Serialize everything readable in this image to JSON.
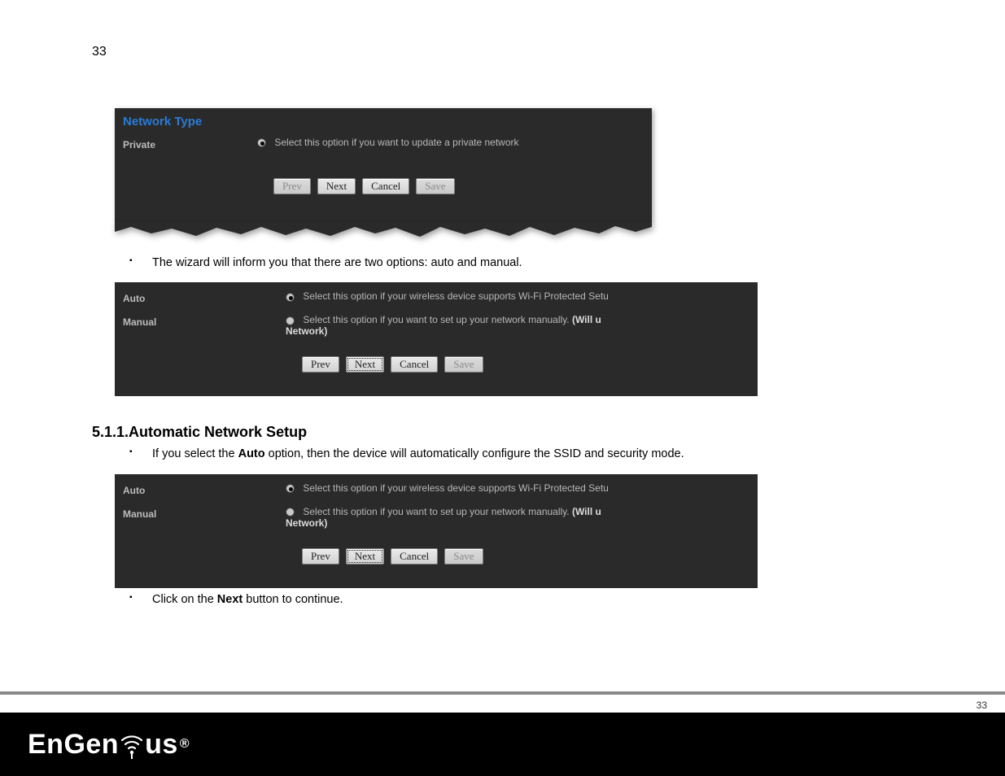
{
  "page_number_top": "33",
  "page_number_bottom": "33",
  "shot1": {
    "header": "Network Type",
    "row_label": "Private",
    "row_desc": "Select this option if you want to update a private network",
    "buttons": {
      "prev": "Prev",
      "next": "Next",
      "cancel": "Cancel",
      "save": "Save"
    }
  },
  "bullet1": "The wizard will inform you that there are two options: auto and manual.",
  "shot2": {
    "auto_label": "Auto",
    "auto_desc": "Select this option if your wireless device supports Wi-Fi Protected Setu",
    "manual_label": "Manual",
    "manual_desc_a": "Select this option if you want to set up your network manually. ",
    "manual_desc_b": "(Will u",
    "manual_desc_c": "Network)",
    "buttons": {
      "prev": "Prev",
      "next": "Next",
      "cancel": "Cancel",
      "save": "Save"
    }
  },
  "section_heading": "5.1.1.Automatic Network Setup",
  "bullet2_a": "If you select the ",
  "bullet2_b": "Auto",
  "bullet2_c": " option, then the device will automatically configure the SSID and security mode.",
  "bullet3_a": "Click on the ",
  "bullet3_b": "Next",
  "bullet3_c": " button to continue.",
  "brand": "EnGenius"
}
